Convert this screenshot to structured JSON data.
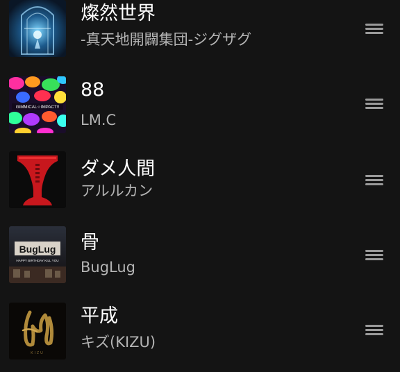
{
  "queue": {
    "items": [
      {
        "title": "燦然世界",
        "artist": "-真天地開闢集団-ジグザグ",
        "art_icon": "album-art-blue-temple",
        "art_text": ""
      },
      {
        "title": "88",
        "artist": "LM.C",
        "art_icon": "album-art-rainbow-leopard",
        "art_text": "GIMMICAL☆IMPACT!!"
      },
      {
        "title": "ダメ人間",
        "artist": "アルルカン",
        "art_icon": "album-art-red-chalice",
        "art_text": ""
      },
      {
        "title": "骨",
        "artist": "BugLug",
        "art_icon": "album-art-stage-logo",
        "art_text": "BugLug",
        "art_subtext": "HAPPY BIRTHDAY KILL YOU"
      },
      {
        "title": "平成",
        "artist": "キズ(KIZU)",
        "art_icon": "album-art-gold-calligraphy",
        "art_text": "KIZU"
      }
    ],
    "drag_handle_icon": "drag-handle-icon"
  }
}
